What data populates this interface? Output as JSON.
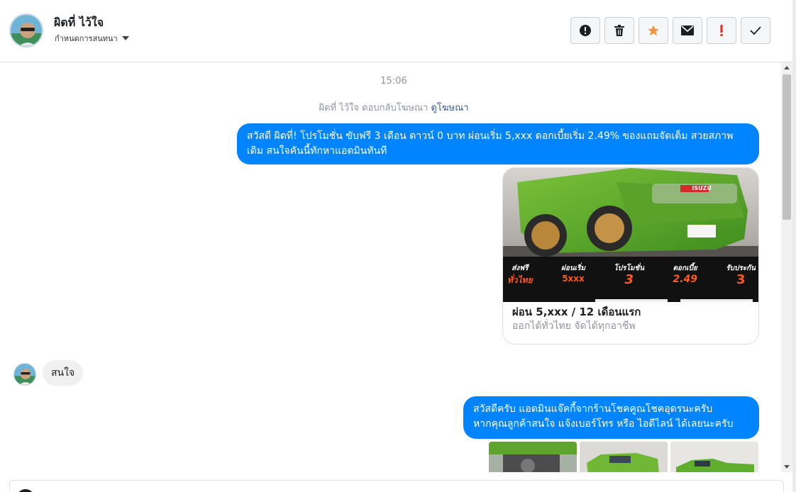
{
  "header": {
    "contact_name": "ผิดที่ ไว้ใจ",
    "assign_label": "กำหนดการสนทนา",
    "toolbar": [
      {
        "name": "spam-button",
        "icon": "alert-circle-icon"
      },
      {
        "name": "delete-button",
        "icon": "trash-icon"
      },
      {
        "name": "star-button",
        "icon": "star-icon"
      },
      {
        "name": "mark-unread-button",
        "icon": "envelope-icon"
      },
      {
        "name": "follow-up-button",
        "icon": "exclamation-icon"
      },
      {
        "name": "done-button",
        "icon": "check-icon"
      }
    ]
  },
  "thread": {
    "timestamp": "15:06",
    "ad_note_prefix": "ผิดที่ ไว้ใจ ตอบกลับโฆษณา",
    "ad_note_link": "ดูโฆษณา",
    "msg1": "สวัสดี ผิดที่! โปรโมชั่น ขับฟรี 3 เดือน ดาวน์ 0 บาท ผ่อนเริ่ม 5,xxx  ดอกเบี้ยเริ่ม 2.49% ของแถมจัดเต็ม สวยสภาพเดิม สนใจคันนี้ทักหาแอดมินทันที",
    "card": {
      "title": "ผ่อน 5,xxx / 12 เดือนแรก",
      "subtitle": "ออกได้ทั่วไทย จัดได้ทุกอาชีพ",
      "banner": {
        "badge": "ISUZU",
        "items": [
          {
            "top": "ส่งฟรี",
            "main": "ทั่วไทย"
          },
          {
            "top": "ผ่อนเริ่ม",
            "main": "5xxx"
          },
          {
            "top": "โปรโมชั่น",
            "main": "3"
          },
          {
            "top": "ดอกเบี้ย",
            "main": "2.49"
          },
          {
            "top": "รับประกัน",
            "main": "3"
          }
        ]
      }
    },
    "reply_in": "สนใจ",
    "msg2_line1": "สวัสดีครับ แอดมินแจ๊คกี้จากร้านโชคคูณโชคอุดรนะครับ",
    "msg2_line2": "หากคุณลูกค้าสนใจ แจ้งเบอร์โทร หรือ ไอดีไลน์ ได้เลยนะครับ"
  },
  "colors": {
    "accent": "#0084ff",
    "star": "#f7923a",
    "exclaim": "#e4221f"
  }
}
